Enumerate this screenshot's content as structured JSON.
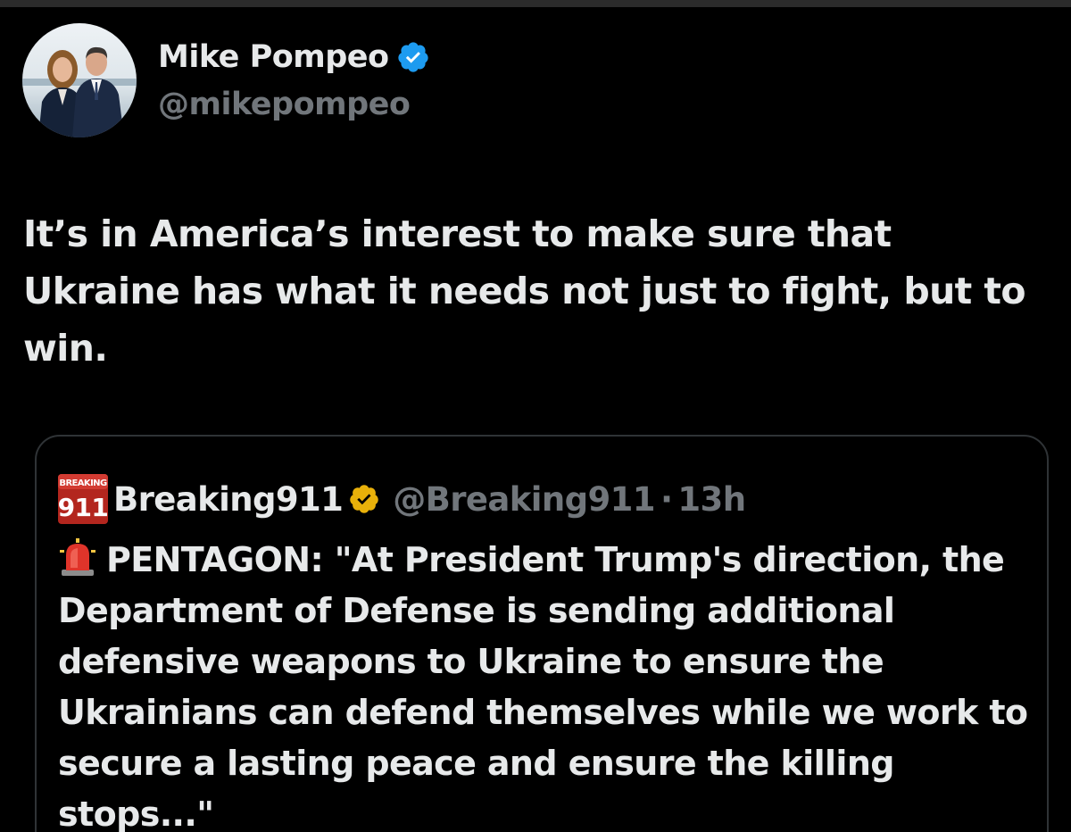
{
  "author": {
    "name": "Mike Pompeo",
    "handle": "@mikepompeo",
    "verified_icon": "blue-verified-badge-icon",
    "verified_color": "#1d9bf0"
  },
  "tweet": {
    "text": "It’s in America’s interest to make sure that Ukraine has what it needs not just to fight, but to win."
  },
  "quoted": {
    "logo_small": "BREAKING",
    "logo_big": "911",
    "name": "Breaking911",
    "verified_icon": "gold-verified-badge-icon",
    "verified_color": "#e9b10a",
    "handle": "@Breaking911",
    "separator": "·",
    "time": "13h",
    "emoji_icon": "police-siren-icon",
    "text": "PENTAGON: \"At President Trump's direction, the Department of Defense is sending additional defensive weapons to Ukraine to ensure the Ukrainians can defend themselves while we work to secure a lasting peace and ensure the killing stops...\""
  },
  "colors": {
    "background": "#000000",
    "primary_text": "#e7e9ea",
    "secondary_text": "#71767b",
    "card_border": "#2f3336"
  }
}
